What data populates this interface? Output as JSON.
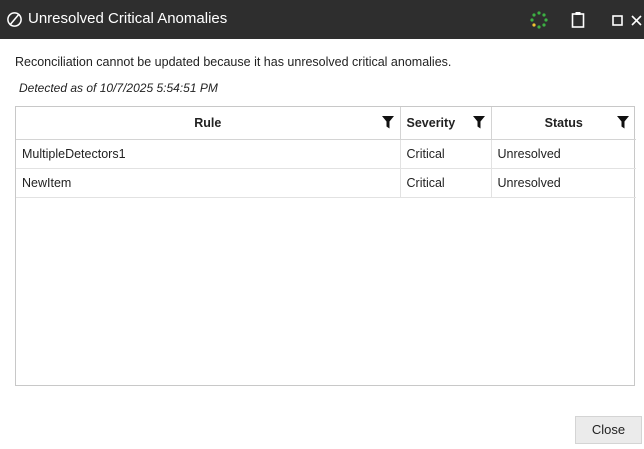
{
  "dialog": {
    "title": "Unresolved Critical Anomalies",
    "title_icon": "slashed-circle-icon",
    "titlebar_buttons": [
      "spinner-icon",
      "clipboard-icon",
      "maximize-icon",
      "close-icon"
    ]
  },
  "message": "Reconciliation cannot be updated because it has unresolved critical anomalies.",
  "detected": {
    "prefix": "Detected as of",
    "timestamp": "10/7/2025 5:54:51 PM"
  },
  "grid": {
    "columns": [
      {
        "label": "Rule",
        "filter_icon": "filter-icon"
      },
      {
        "label": "Severity",
        "filter_icon": "filter-icon"
      },
      {
        "label": "Status",
        "filter_icon": "filter-icon"
      }
    ],
    "rows": [
      {
        "rule": "MultipleDetectors1",
        "severity": "Critical",
        "status": "Unresolved"
      },
      {
        "rule": "NewItem",
        "severity": "Critical",
        "status": "Unresolved"
      }
    ]
  },
  "footer": {
    "close_label": "Close"
  },
  "colors": {
    "titlebar_bg": "#2e2e2e",
    "spinner_green": "#3cb043",
    "grid_border": "#c8c8c8"
  }
}
